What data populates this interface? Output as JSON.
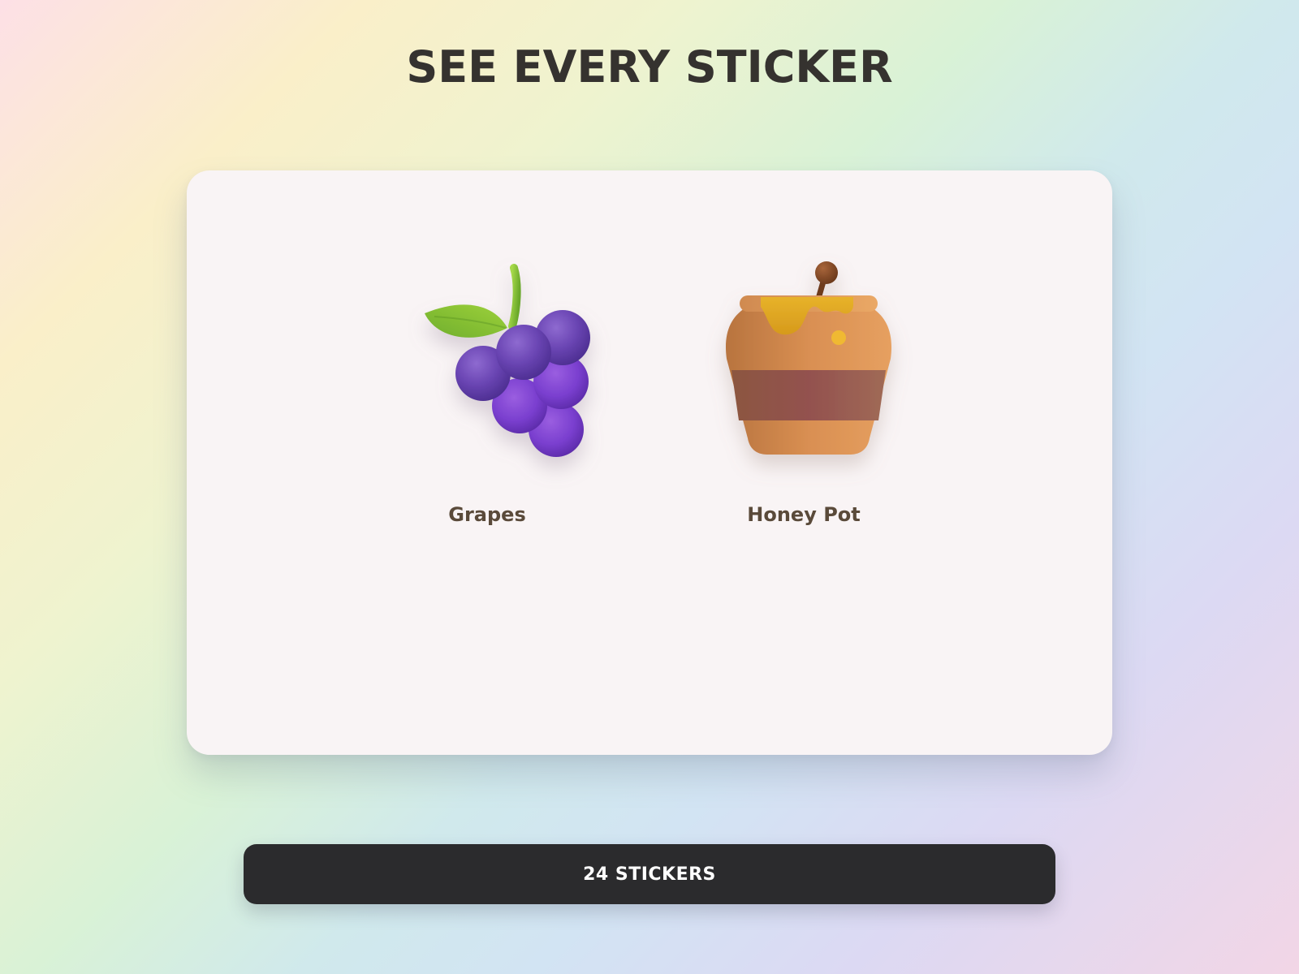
{
  "page": {
    "title": "SEE EVERY STICKER"
  },
  "stickers": [
    {
      "label": "Grapes",
      "icon": "grapes-icon"
    },
    {
      "label": "Honey Pot",
      "icon": "honey-pot-icon"
    }
  ],
  "footer": {
    "count_label": "24 STICKERS"
  },
  "colors": {
    "title": "#35322f",
    "card_background": "#f9f4f5",
    "label": "#5a4a3a",
    "button_background": "#2b2b2d",
    "button_text": "#ffffff"
  }
}
